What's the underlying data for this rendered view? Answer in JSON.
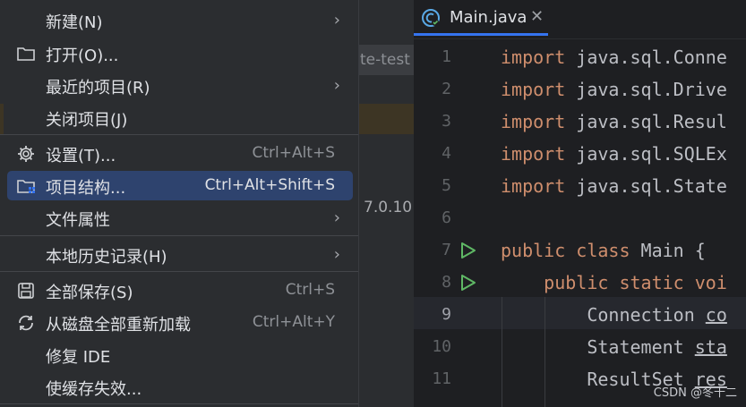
{
  "menu": {
    "items": [
      {
        "label": "新建(N)",
        "icon": "",
        "shortcut": "",
        "submenu": true
      },
      {
        "label": "打开(O)...",
        "icon": "folder-icon",
        "shortcut": "",
        "submenu": false
      },
      {
        "label": "最近的项目(R)",
        "icon": "",
        "shortcut": "",
        "submenu": true
      },
      {
        "label": "关闭项目(J)",
        "icon": "",
        "shortcut": "",
        "submenu": false
      },
      {
        "label": "设置(T)...",
        "icon": "gear-icon",
        "shortcut": "Ctrl+Alt+S",
        "submenu": false
      },
      {
        "label": "项目结构...",
        "icon": "project-structure-icon",
        "shortcut": "Ctrl+Alt+Shift+S",
        "submenu": false,
        "selected": true
      },
      {
        "label": "文件属性",
        "icon": "",
        "shortcut": "",
        "submenu": true
      },
      {
        "label": "本地历史记录(H)",
        "icon": "",
        "shortcut": "",
        "submenu": true
      },
      {
        "label": "全部保存(S)",
        "icon": "save-icon",
        "shortcut": "Ctrl+S",
        "submenu": false
      },
      {
        "label": "从磁盘全部重新加载",
        "icon": "reload-icon",
        "shortcut": "Ctrl+Alt+Y",
        "submenu": false
      },
      {
        "label": "修复 IDE",
        "icon": "",
        "shortcut": "",
        "submenu": false
      },
      {
        "label": "使缓存失效...",
        "icon": "",
        "shortcut": "",
        "submenu": false
      }
    ],
    "submenu_arrow": "›"
  },
  "background": {
    "project_chip": "te-test",
    "version_text": "7.0.10"
  },
  "editor": {
    "tab": {
      "label": "Main.java",
      "close": "✕"
    },
    "lines": [
      {
        "num": "1",
        "parts": [
          {
            "t": "import",
            "k": "kw"
          },
          {
            "t": " java.sql.Conne",
            "k": ""
          }
        ]
      },
      {
        "num": "2",
        "parts": [
          {
            "t": "import",
            "k": "kw"
          },
          {
            "t": " java.sql.Drive",
            "k": ""
          }
        ]
      },
      {
        "num": "3",
        "parts": [
          {
            "t": "import",
            "k": "kw"
          },
          {
            "t": " java.sql.Resul",
            "k": ""
          }
        ]
      },
      {
        "num": "4",
        "parts": [
          {
            "t": "import",
            "k": "kw"
          },
          {
            "t": " java.sql.SQLEx",
            "k": ""
          }
        ]
      },
      {
        "num": "5",
        "parts": [
          {
            "t": "import",
            "k": "kw"
          },
          {
            "t": " java.sql.State",
            "k": ""
          }
        ]
      },
      {
        "num": "6",
        "parts": []
      },
      {
        "num": "7",
        "parts": [
          {
            "t": "public class",
            "k": "kw"
          },
          {
            "t": " Main {",
            "k": ""
          }
        ],
        "run": true
      },
      {
        "num": "8",
        "parts": [
          {
            "t": "    public static voi",
            "k": "kw"
          }
        ],
        "run": true
      },
      {
        "num": "9",
        "parts": [
          {
            "t": "        Connection ",
            "k": ""
          },
          {
            "t": "co",
            "k": "ul2"
          }
        ],
        "current": true
      },
      {
        "num": "10",
        "parts": [
          {
            "t": "        Statement ",
            "k": ""
          },
          {
            "t": "sta",
            "k": "ul2"
          }
        ]
      },
      {
        "num": "11",
        "parts": [
          {
            "t": "        ResultSet ",
            "k": ""
          },
          {
            "t": "res",
            "k": "ul2"
          }
        ]
      }
    ]
  },
  "watermark": "CSDN @冬十二",
  "colors": {
    "accent": "#3574f0",
    "selected": "#2e436e",
    "keyword": "#cf8e6d",
    "run": "#5fb865"
  }
}
